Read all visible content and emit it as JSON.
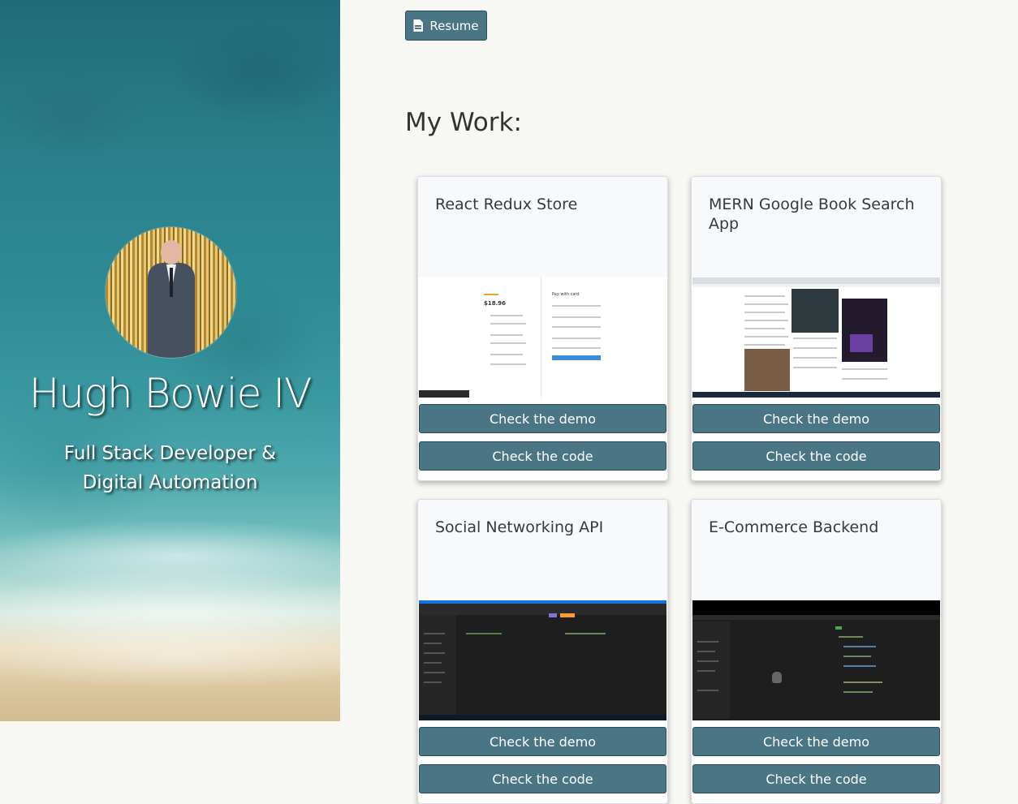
{
  "sidebar": {
    "name": "Hugh Bowie IV",
    "subtitle": "Full Stack Developer & Digital Automation"
  },
  "resume_button": {
    "label": "Resume",
    "icon": "file-icon"
  },
  "section_title": "My Work:",
  "colors": {
    "button": "#4a7584",
    "background": "#f7f7f4"
  },
  "projects": [
    {
      "title": "React Redux Store",
      "demo_label": "Check the demo",
      "code_label": "Check the code",
      "screenshot_price": "$18.96",
      "screenshot_heading": "Pay with card"
    },
    {
      "title": "MERN Google Book Search App",
      "demo_label": "Check the demo",
      "code_label": "Check the code"
    },
    {
      "title": "Social Networking API",
      "demo_label": "Check the demo",
      "code_label": "Check the code"
    },
    {
      "title": "E-Commerce Backend",
      "demo_label": "Check the demo",
      "code_label": "Check the code"
    }
  ]
}
